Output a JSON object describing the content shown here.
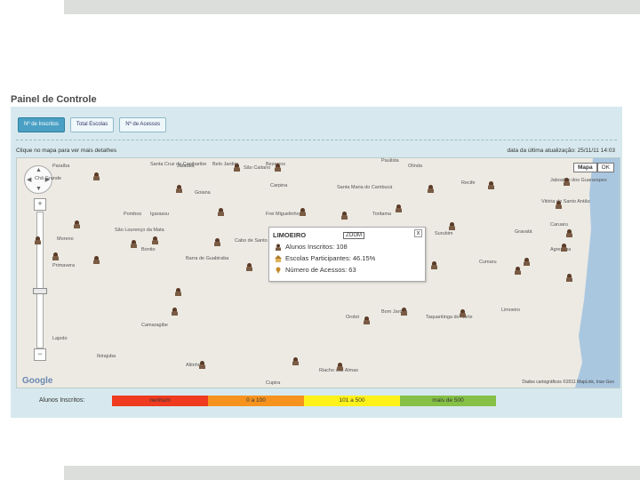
{
  "page": {
    "title": "Painel de Controle"
  },
  "tabs": [
    {
      "label": "Nº de Inscritos",
      "active": true
    },
    {
      "label": "Total Escolas",
      "active": false
    },
    {
      "label": "Nº de Acessos",
      "active": false
    }
  ],
  "map": {
    "hint": "Clique no mapa para ver mais detalhes",
    "last_update": "data da última atualização: 25/11/11 14:03",
    "type_buttons": [
      "Mapa",
      "OK"
    ],
    "attribution": "Dados cartográficos ©2011 MapLink, Inav Geo",
    "logo": "Google",
    "cities": [
      "Paraíba",
      "Santa Cruz do Capibaribe",
      "Jataúba",
      "Belo Jardim",
      "São Caitano",
      "Bezerros",
      "Carpina",
      "Goiana",
      "Igarassu",
      "Paulista",
      "Olinda",
      "Recife",
      "Jaboatão dos Guararapes",
      "Vitória de Santo Antão",
      "Caruaru",
      "Gravatá",
      "Agrestina",
      "Cumaru",
      "Limoeiro",
      "Bom Jardim",
      "Orobó",
      "Surubim",
      "Vertentes",
      "Taquaritinga do Norte",
      "Santa Maria do Cambucá",
      "Frei Miguelinho",
      "Toritama",
      "Riacho das Almas",
      "Cupira",
      "Altinho",
      "Ibirajuba",
      "Lajedo",
      "Camaragibe",
      "São Lourenço da Mata",
      "Moreno",
      "Pombos",
      "Chã Grande",
      "Primavera",
      "Bonito",
      "Barra de Guabiraba",
      "Cabo de Santo Agostinho"
    ]
  },
  "popup": {
    "place": "LIMOEIRO",
    "zoom_link": "ZOOM",
    "close": "x",
    "rows": [
      {
        "icon": "student-icon",
        "text": "Alunos Inscritos: 108"
      },
      {
        "icon": "school-icon",
        "text": "Escolas Participantes: 46.15%"
      },
      {
        "icon": "marker-icon",
        "text": "Número de Acessos: 63"
      }
    ]
  },
  "legend": {
    "label": "Alunos Inscritos:",
    "ranges": [
      {
        "label": "nenhum",
        "color": "#ef3b1f"
      },
      {
        "label": "0 a 100",
        "color": "#f6931f"
      },
      {
        "label": "101 a 500",
        "color": "#fff21a"
      },
      {
        "label": "mais de 500",
        "color": "#86c046"
      }
    ]
  },
  "colors": {
    "panel_bg": "#d7e9ee",
    "tab_active": "#4aa0c4",
    "sea": "#aac7e0"
  }
}
